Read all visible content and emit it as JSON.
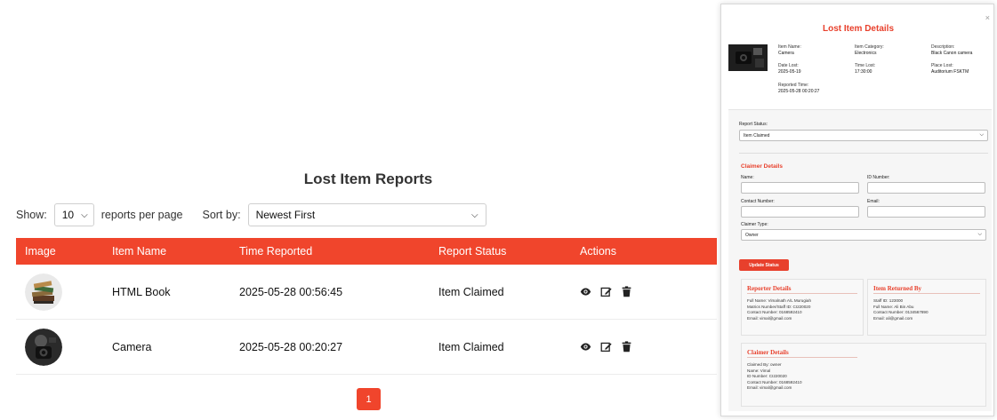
{
  "page": {
    "title": "Lost Item Reports",
    "show_label": "Show:",
    "per_page_value": "10",
    "per_page_suffix": "reports per page",
    "sort_label": "Sort by:",
    "sort_value": "Newest First"
  },
  "table": {
    "headers": [
      "Image",
      "Item Name",
      "Time Reported",
      "Report Status",
      "Actions"
    ],
    "rows": [
      {
        "item_name": "HTML Book",
        "time": "2025-05-28 00:56:45",
        "status": "Item Claimed",
        "image_icon": "book-stack-icon"
      },
      {
        "item_name": "Camera",
        "time": "2025-05-28 00:20:27",
        "status": "Item Claimed",
        "image_icon": "camera-photo-icon"
      }
    ],
    "action_icons": [
      "eye-icon",
      "edit-icon",
      "trash-icon"
    ]
  },
  "pagination": {
    "current": "1"
  },
  "modal": {
    "close": "×",
    "title": "Lost Item Details",
    "item_name_label": "Item Name:",
    "item_name": "Camera",
    "category_label": "Item Category:",
    "category": "Electronics",
    "description_label": "Description:",
    "description": "Black Canon camera",
    "date_lost_label": "Date Lost:",
    "date_lost": "2025-05-19",
    "time_lost_label": "Time Lost:",
    "time_lost": "17:30:00",
    "place_lost_label": "Place Lost:",
    "place_lost": "Auditorium FSKTM",
    "reported_time_label": "Reported Time:",
    "reported_time": "2025-05-28 00:20:27",
    "report_status_label": "Report Status:",
    "report_status_value": "Item Claimed",
    "claimer_section_title": "Claimer Details",
    "name_label": "Name:",
    "id_number_label": "ID Number:",
    "contact_label": "Contact Number:",
    "email_label": "Email:",
    "claimer_type_label": "Claimer Type:",
    "claimer_type_value": "Owner",
    "update_button": "Update Status",
    "reporter_card": {
      "title": "Reporter Details",
      "lines": [
        "Full Name: Vimalnath A/L Murugiah",
        "Matrics Number/Staff ID: CI220020",
        "Contact Number: 0168592410",
        "Email: vimal@gmail.com"
      ]
    },
    "returned_card": {
      "title": "Item Returned By",
      "lines": [
        "Staff ID: 123000",
        "Full Name: Ali Bin Abu",
        "Contact Number: 0134567890",
        "Email: ali@gmail.com"
      ]
    },
    "claimer_card": {
      "title": "Claimer Details",
      "lines": [
        "Claimed By: owner",
        "Name: Vimal",
        "ID Number: CI220020",
        "Contact Number: 0168592410",
        "Email: vimal@gmail.com"
      ]
    }
  },
  "colors": {
    "accent": "#f0452c",
    "modal_accent": "#e8402c"
  }
}
